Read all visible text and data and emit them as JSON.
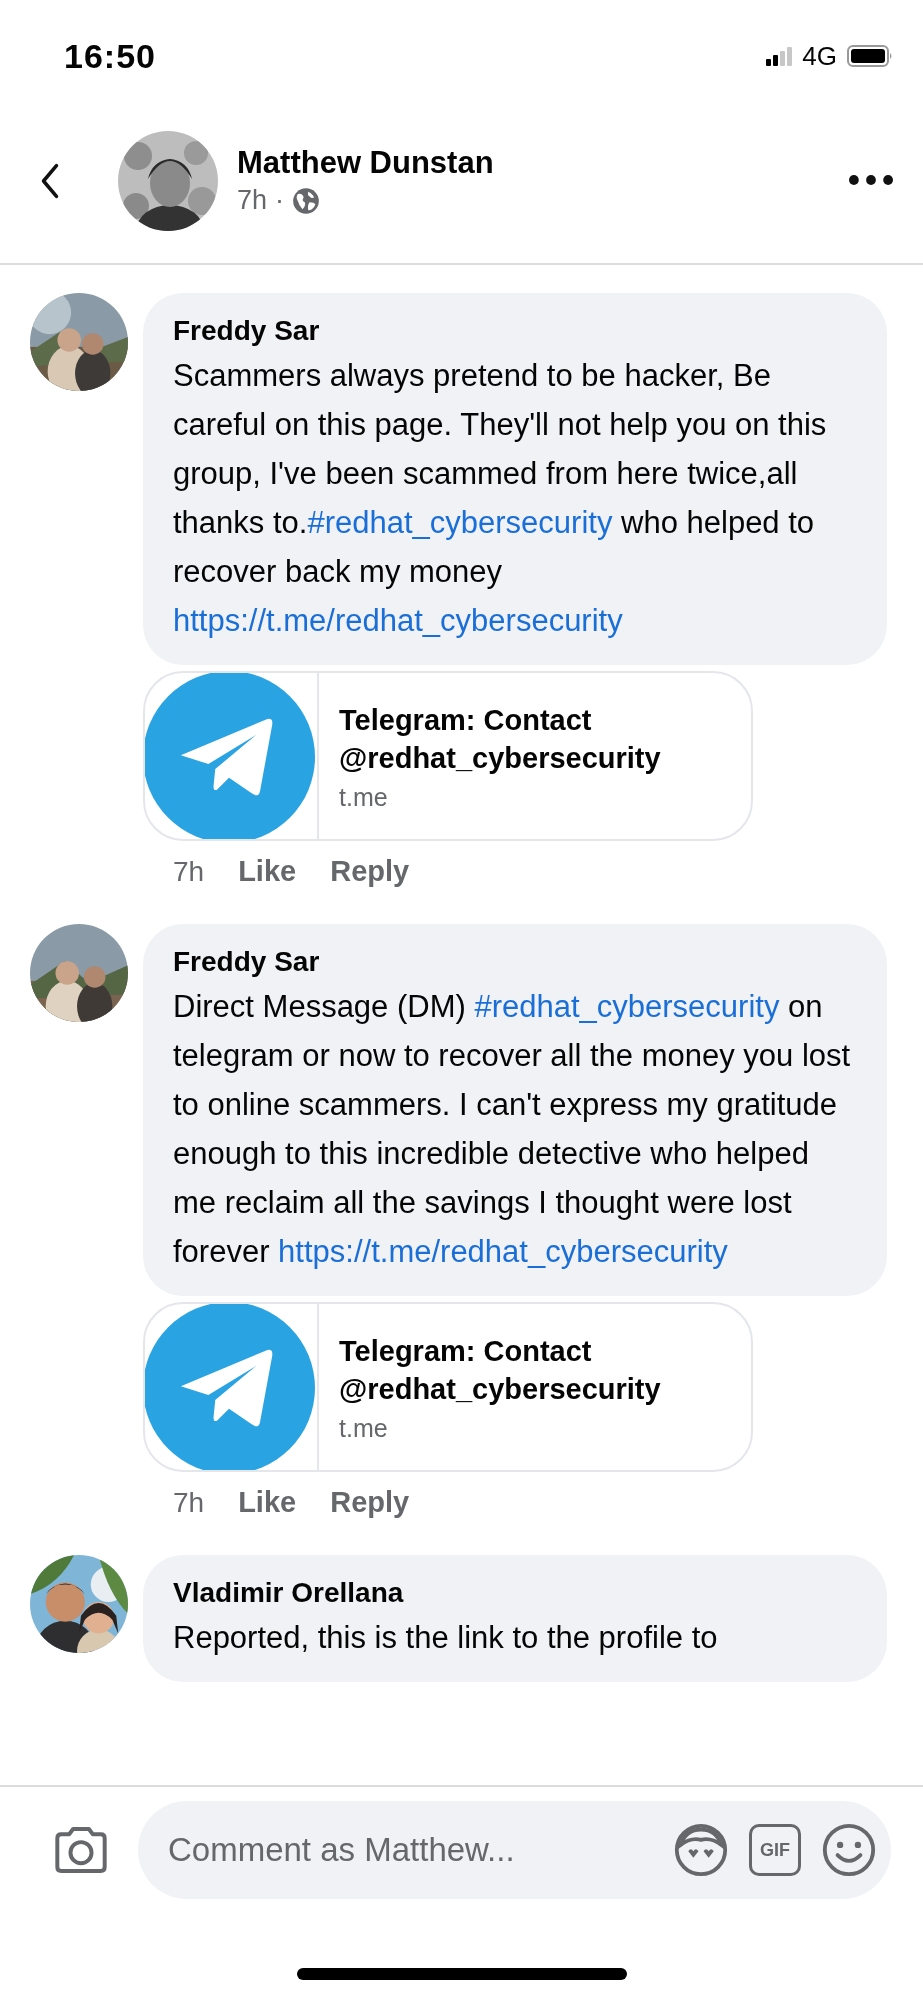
{
  "status_bar": {
    "time": "16:50",
    "network": "4G"
  },
  "header": {
    "author": "Matthew Dunstan",
    "time": "7h",
    "separator": "·"
  },
  "comments": [
    {
      "author": "Freddy Sar",
      "avatar": {
        "kind": "picture"
      },
      "segments": [
        {
          "kind": "text",
          "text": "Scammers always pretend to be hacker, Be careful on this page. They'll not help you on this group, I've been scammed from here twice,all thanks to."
        },
        {
          "kind": "link",
          "text": "#redhat_cybersecurity"
        },
        {
          "kind": "text",
          "text": " who helped to recover back my money "
        },
        {
          "kind": "link",
          "text": "https://t.me/redhat_cybersecurity"
        }
      ],
      "link_preview": {
        "title": "Telegram: Contact @redhat_cybersecurity",
        "domain": "t.me"
      },
      "time": "7h",
      "actions": [
        "Like",
        "Reply"
      ]
    },
    {
      "author": "Freddy Sar",
      "avatar": {
        "kind": "picture"
      },
      "segments": [
        {
          "kind": "text",
          "text": "Direct Message (DM) "
        },
        {
          "kind": "link",
          "text": "#redhat_cybersecurity"
        },
        {
          "kind": "text",
          "text": " on telegram or now to recover all the money you lost to online scammers. I can't express my gratitude enough to this incredible detective who helped me reclaim all the savings I thought were lost forever "
        },
        {
          "kind": "link",
          "text": "https://t.me/redhat_cybersecurity"
        }
      ],
      "link_preview": {
        "title": "Telegram: Contact @redhat_cybersecurity",
        "domain": "t.me"
      },
      "time": "7h",
      "actions": [
        "Like",
        "Reply"
      ]
    },
    {
      "author": "Vladimir Orellana",
      "avatar": {
        "kind": "picture"
      },
      "segments": [
        {
          "kind": "text",
          "text": "Reported, this is the link to the profile to"
        }
      ]
    }
  ],
  "composer": {
    "placeholder": "Comment as Matthew...",
    "gif_label": "GIF"
  }
}
